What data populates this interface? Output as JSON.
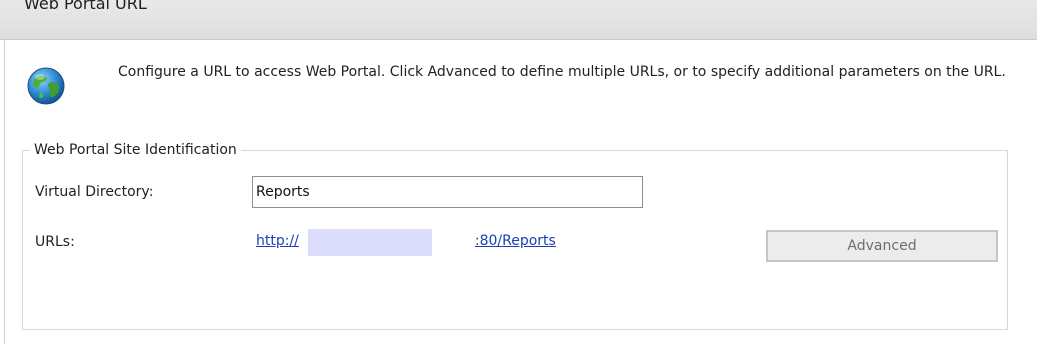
{
  "header": {
    "title": "Web Portal URL"
  },
  "intro": {
    "icon": "globe-icon",
    "text": "Configure a URL to access Web Portal.  Click Advanced to define multiple URLs, or to specify additional parameters on the URL."
  },
  "site_identification": {
    "legend": "Web Portal Site Identification",
    "virtual_directory_label": "Virtual Directory:",
    "virtual_directory_value": "Reports",
    "urls_label": "URLs:",
    "url_prefix": "http://",
    "url_suffix": ":80/Reports",
    "advanced_label": "Advanced"
  },
  "colors": {
    "link": "#1a3fb8",
    "header_bg": "#e3e3e3",
    "redaction": "#dcdcfb"
  }
}
